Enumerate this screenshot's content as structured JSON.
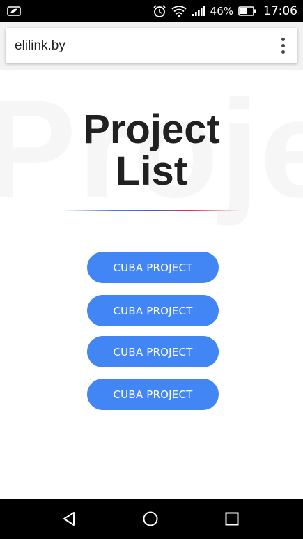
{
  "status_bar": {
    "battery_percent": "46%",
    "time": "17:06",
    "icons": [
      "notification-leaf-icon",
      "alarm-icon",
      "wifi-icon",
      "signal-icon",
      "battery-icon"
    ]
  },
  "browser": {
    "url": "elilink.by",
    "menu_icon": "more-vert-icon"
  },
  "page": {
    "background_word": "Proje",
    "title_line1": "Project",
    "title_line2": "List",
    "buttons": [
      {
        "label": "CUBA PROJECT"
      },
      {
        "label": "CUBA PROJECT"
      },
      {
        "label": "CUBA PROJECT"
      },
      {
        "label": "CUBA PROJECT"
      }
    ]
  },
  "nav_bar": {
    "icons": [
      "back-icon",
      "home-icon",
      "recents-icon"
    ]
  },
  "colors": {
    "button": "#4285f4",
    "title": "#212121",
    "divider_blue": "#3b63c9",
    "divider_red": "#d8334a"
  }
}
